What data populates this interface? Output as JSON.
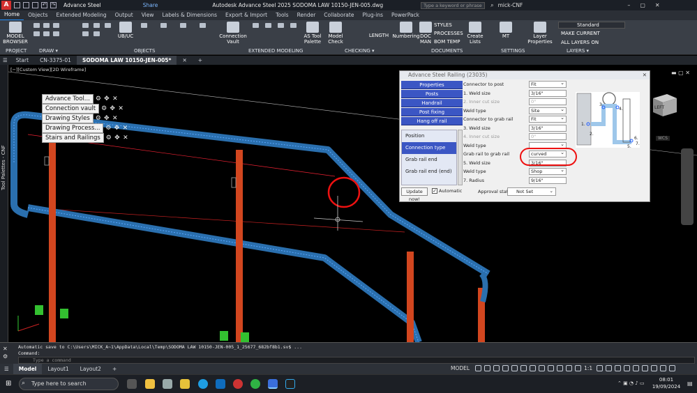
{
  "app": {
    "title": "Autodesk Advance Steel 2025    SODOMA LAW 10150-JEN-005.dwg",
    "workspace": "Advance Steel",
    "share": "Share",
    "search_placeholder": "Type a keyword or phrase",
    "user": "mick-CNF"
  },
  "ribbon_tabs": [
    "Home",
    "Objects",
    "Extended Modeling",
    "Output",
    "View",
    "Labels & Dimensions",
    "Export & Import",
    "Tools",
    "Render",
    "Collaborate",
    "Plug-ins",
    "PowerPack"
  ],
  "ribbon": {
    "model_browser": "MODEL\nBROWSER",
    "ub_uc": "UB/UC",
    "connection_vault": "Connection\nVault",
    "as_tool_palette": "AS Tool\nPalette",
    "model_check": "Model\nCheck",
    "length": "LENGTH",
    "numbering": "Numbering",
    "doc_man": "DOC\nMAN",
    "styles": "STYLES",
    "processes": "PROCESSES",
    "bom_temp": "BOM TEMP",
    "create_lists": "Create\nLists",
    "mt": "MT",
    "layer_properties": "Layer\nProperties",
    "standard": "Standard",
    "make_current": "MAKE CURRENT",
    "all_layers_on": "ALL LAYERS ON",
    "panels": [
      "PROJECT",
      "DRAW ▾",
      "OBJECTS",
      "EXTENDED MODELING",
      "CHECKING ▾",
      "DOCUMENTS",
      "SETTINGS",
      "LAYERS ▾"
    ]
  },
  "doc_tabs": [
    "Start",
    "CN-3375-01",
    "SODOMA LAW 10150-JEN-005*"
  ],
  "viewport": {
    "view_label": "[−][Custom View][2D Wireframe]",
    "tool_palettes": "Tool Palettes - CNF",
    "viewcube_face": "LEFT",
    "wcs": "WCS",
    "palette_buttons": [
      "Advance Tool...",
      "Connection vault",
      "Drawing Styles",
      "Drawing Process...",
      "Stairs and Railings"
    ]
  },
  "dialog": {
    "title": "Advance Steel   Railing (23035)",
    "nav_buttons": [
      "Properties",
      "Posts",
      "Handrail",
      "Post fixing",
      "Hang off rail"
    ],
    "nav_list": [
      "Position",
      "Connection type",
      "Grab rail end",
      "Grab rail end (end)"
    ],
    "properties": [
      {
        "label": "Connector to post",
        "value": "Fit"
      },
      {
        "label": "1. Weld size",
        "value": "3/16\""
      },
      {
        "label": "2. Inner cut size",
        "value": "0\""
      },
      {
        "label": "Weld type",
        "value": "Site"
      },
      {
        "label": "Connector to grab rail",
        "value": "Fit"
      },
      {
        "label": "3. Weld size",
        "value": "3/16\""
      },
      {
        "label": "4. Inner cut size",
        "value": "0\""
      },
      {
        "label": "Weld type",
        "value": ""
      },
      {
        "label": "Grab rail to grab rail",
        "value": "curved"
      },
      {
        "label": "5. Weld size",
        "value": "3/16\""
      },
      {
        "label": "Weld type",
        "value": "Shop"
      },
      {
        "label": "7. Radius",
        "value": "9/16\""
      }
    ],
    "diagram_labels": [
      "1.",
      "2.",
      "3.",
      "4.",
      "5.",
      "6.",
      "7."
    ],
    "update_now": "Update now!",
    "automatic": "Automatic",
    "approval_status": "Approval status",
    "approval_value": "Not Set"
  },
  "command": {
    "line1": "Automatic save to C:\\Users\\MICK_A~1\\AppData\\Local\\Temp\\SODOMA LAW 10150-JEN-005_1_25677_682bf8b1.sv$ ...",
    "line2": "Command:",
    "placeholder": "Type a command"
  },
  "layouts": [
    "Model",
    "Layout1",
    "Layout2"
  ],
  "status": {
    "model": "MODEL",
    "scale": "1:1"
  },
  "taskbar": {
    "search": "Type here to search",
    "time": "08:01",
    "date": "19/09/2024"
  }
}
